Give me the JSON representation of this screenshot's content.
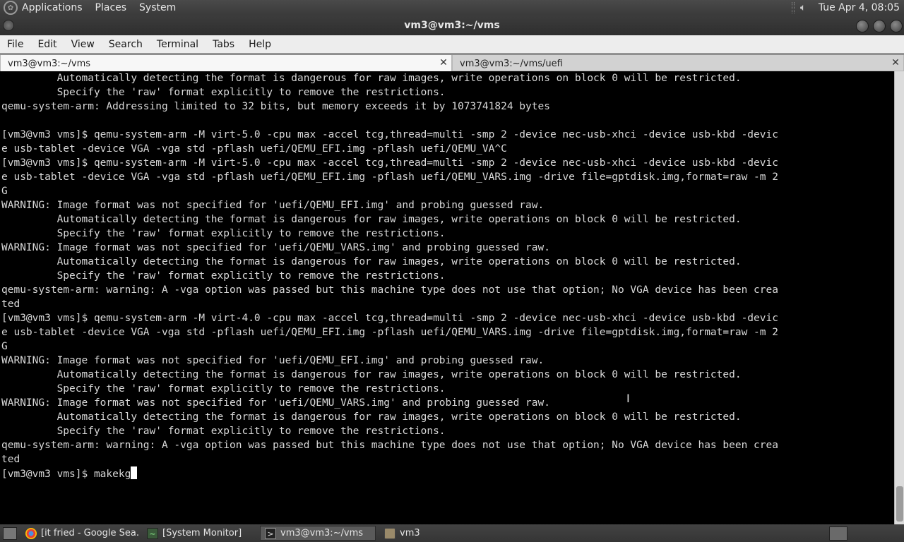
{
  "top_panel": {
    "menus": [
      "Applications",
      "Places",
      "System"
    ],
    "clock": "Tue Apr  4, 08:05"
  },
  "window": {
    "title": "vm3@vm3:~/vms"
  },
  "menubar": {
    "items": [
      "File",
      "Edit",
      "View",
      "Search",
      "Terminal",
      "Tabs",
      "Help"
    ]
  },
  "tabs": [
    {
      "label": "vm3@vm3:~/vms",
      "close": "✕"
    },
    {
      "label": "vm3@vm3:~/vms/uefi",
      "close": "✕"
    }
  ],
  "terminal": {
    "lines": [
      "         Automatically detecting the format is dangerous for raw images, write operations on block 0 will be restricted.",
      "         Specify the 'raw' format explicitly to remove the restrictions.",
      "qemu-system-arm: Addressing limited to 32 bits, but memory exceeds it by 1073741824 bytes",
      "",
      "[vm3@vm3 vms]$ qemu-system-arm -M virt-5.0 -cpu max -accel tcg,thread=multi -smp 2 -device nec-usb-xhci -device usb-kbd -devic",
      "e usb-tablet -device VGA -vga std -pflash uefi/QEMU_EFI.img -pflash uefi/QEMU_VA^C",
      "[vm3@vm3 vms]$ qemu-system-arm -M virt-5.0 -cpu max -accel tcg,thread=multi -smp 2 -device nec-usb-xhci -device usb-kbd -devic",
      "e usb-tablet -device VGA -vga std -pflash uefi/QEMU_EFI.img -pflash uefi/QEMU_VARS.img -drive file=gptdisk.img,format=raw -m 2",
      "G",
      "WARNING: Image format was not specified for 'uefi/QEMU_EFI.img' and probing guessed raw.",
      "         Automatically detecting the format is dangerous for raw images, write operations on block 0 will be restricted.",
      "         Specify the 'raw' format explicitly to remove the restrictions.",
      "WARNING: Image format was not specified for 'uefi/QEMU_VARS.img' and probing guessed raw.",
      "         Automatically detecting the format is dangerous for raw images, write operations on block 0 will be restricted.",
      "         Specify the 'raw' format explicitly to remove the restrictions.",
      "qemu-system-arm: warning: A -vga option was passed but this machine type does not use that option; No VGA device has been crea",
      "ted",
      "[vm3@vm3 vms]$ qemu-system-arm -M virt-4.0 -cpu max -accel tcg,thread=multi -smp 2 -device nec-usb-xhci -device usb-kbd -devic",
      "e usb-tablet -device VGA -vga std -pflash uefi/QEMU_EFI.img -pflash uefi/QEMU_VARS.img -drive file=gptdisk.img,format=raw -m 2",
      "G",
      "WARNING: Image format was not specified for 'uefi/QEMU_EFI.img' and probing guessed raw.",
      "         Automatically detecting the format is dangerous for raw images, write operations on block 0 will be restricted.",
      "         Specify the 'raw' format explicitly to remove the restrictions.",
      "WARNING: Image format was not specified for 'uefi/QEMU_VARS.img' and probing guessed raw.",
      "         Automatically detecting the format is dangerous for raw images, write operations on block 0 will be restricted.",
      "         Specify the 'raw' format explicitly to remove the restrictions.",
      "qemu-system-arm: warning: A -vga option was passed but this machine type does not use that option; No VGA device has been crea",
      "ted"
    ],
    "prompt_line": "[vm3@vm3 vms]$ makekg"
  },
  "taskbar": {
    "items": [
      {
        "label": "[it fried - Google Sea...",
        "icon": "chrome-icon",
        "active": false
      },
      {
        "label": "[System Monitor]",
        "icon": "system-monitor-icon",
        "active": false
      },
      {
        "label": "vm3@vm3:~/vms",
        "icon": "terminal-icon",
        "active": true
      },
      {
        "label": "vm3",
        "icon": "folder-icon",
        "active": false
      }
    ]
  },
  "colors": {
    "terminal_bg": "#000000",
    "terminal_fg": "#d8d8d8",
    "panel_bg": "#3c3c3c"
  }
}
